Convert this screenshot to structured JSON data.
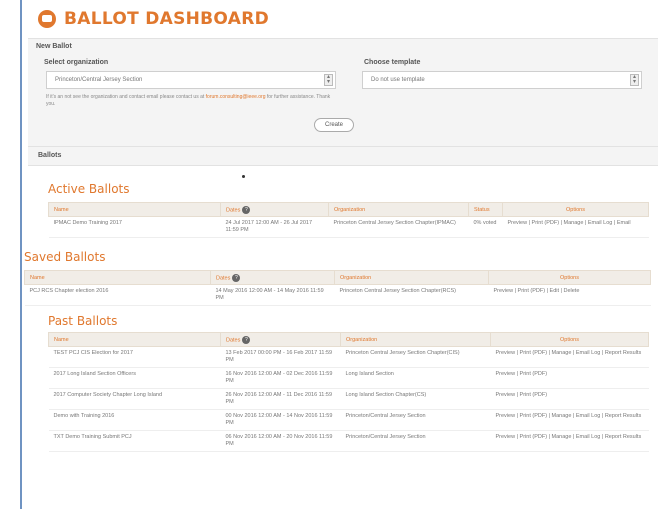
{
  "header": {
    "title": "BALLOT DASHBOARD",
    "logo_icon": "ballot-box-icon",
    "accent": "#e0782e"
  },
  "new_ballot": {
    "section_title": "New Ballot",
    "org_label": "Select organization",
    "org_value": "Princeton/Central Jersey Section",
    "template_label": "Choose template",
    "template_value": "Do not use template",
    "note_text": "If it's an not see the organization and contact email please contact us at",
    "note_link": "forum.consulting@ieee.org",
    "note_tail": "for further assistance. Thank you.",
    "create_label": "Create"
  },
  "ballots_bar": {
    "label": "Ballots"
  },
  "active": {
    "title": "Active Ballots",
    "headers": [
      "Name",
      "Dates",
      "Organization",
      "Status",
      "Options"
    ],
    "rows": [
      {
        "name": "IPMAC Demo Training 2017",
        "dates": "24 Jul 2017 12:00 AM - 26 Jul 2017 11:59 PM",
        "org": "Princeton Central Jersey Section Chapter(IPMAC)",
        "status": "0% voted",
        "options": "Preview | Print (PDF) | Manage | Email Log | Email"
      }
    ]
  },
  "saved": {
    "title": "Saved Ballots",
    "headers": [
      "Name",
      "Dates",
      "Organization",
      "Options"
    ],
    "rows": [
      {
        "name": "PCJ RCS Chapter election 2016",
        "dates": "14 May 2016 12:00 AM - 14 May 2016 11:59 PM",
        "org": "Princeton Central Jersey Section Chapter(RCS)",
        "options": "Preview | Print (PDF) | Edit | Delete"
      }
    ]
  },
  "past": {
    "title": "Past Ballots",
    "headers": [
      "Name",
      "Dates",
      "Organization",
      "Options"
    ],
    "rows": [
      {
        "name": "TEST PCJ CIS Election for 2017",
        "dates": "13 Feb 2017 00:00 PM - 16 Feb 2017 11:59 PM",
        "org": "Princeton Central Jersey Section Chapter(CIS)",
        "options": "Preview | Print (PDF) | Manage | Email Log | Report Results"
      },
      {
        "name": "2017 Long Island Section Officers",
        "dates": "16 Nov 2016 12:00 AM - 02 Dec 2016 11:59 PM",
        "org": "Long Island Section",
        "options": "Preview | Print (PDF)"
      },
      {
        "name": "2017 Computer Society Chapter Long Island",
        "dates": "26 Nov 2016 12:00 AM - 11 Dec 2016 11:59 PM",
        "org": "Long Island Section Chapter(CS)",
        "options": "Preview | Print (PDF)"
      },
      {
        "name": "Demo with Training 2016",
        "dates": "00 Nov 2016 12:00 AM - 14 Nov 2016 11:59 PM",
        "org": "Princeton/Central Jersey Section",
        "options": "Preview | Print (PDF) | Manage | Email Log | Report Results"
      },
      {
        "name": "TXT Demo Training Submit PCJ",
        "dates": "06 Nov 2016 12:00 AM - 20 Nov 2016 11:59 PM",
        "org": "Princeton/Central Jersey Section",
        "options": "Preview | Print (PDF) | Manage | Email Log | Report Results"
      }
    ]
  }
}
